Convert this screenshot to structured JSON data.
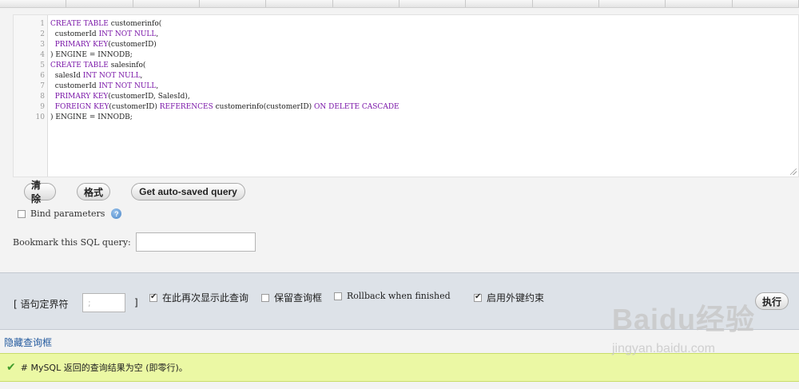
{
  "editor": {
    "line_numbers": [
      "1",
      "2",
      "3",
      "4",
      "5",
      "6",
      "7",
      "8",
      "9",
      "10"
    ]
  },
  "buttons": {
    "clear": "清除",
    "format": "格式",
    "autosaved": "Get auto-saved query",
    "go": "执行"
  },
  "bind_parameters": {
    "label": "Bind parameters",
    "checked": false
  },
  "bookmark": {
    "label": "Bookmark this SQL query:",
    "value": ""
  },
  "options": {
    "delimiter_label": "[ 语句定界符",
    "delimiter_value": ";",
    "delimiter_close": "]",
    "show_again": {
      "label": "在此再次显示此查询",
      "checked": true
    },
    "retain_box": {
      "label": "保留查询框",
      "checked": false
    },
    "rollback": {
      "label": "Rollback when finished",
      "checked": false
    },
    "foreign_keys": {
      "label": "启用外键约束",
      "checked": true
    }
  },
  "hide_query_link": "隐藏查询框",
  "result_message": "# MySQL 返回的查询结果为空 (即零行)。",
  "watermark": {
    "logo": "Baidu经验",
    "url": "jingyan.baidu.com"
  },
  "colors": {
    "keyword": "#7a16a8",
    "success_bg": "#ebf8a4",
    "options_bg": "#dde2e8",
    "link": "#235a9e"
  }
}
